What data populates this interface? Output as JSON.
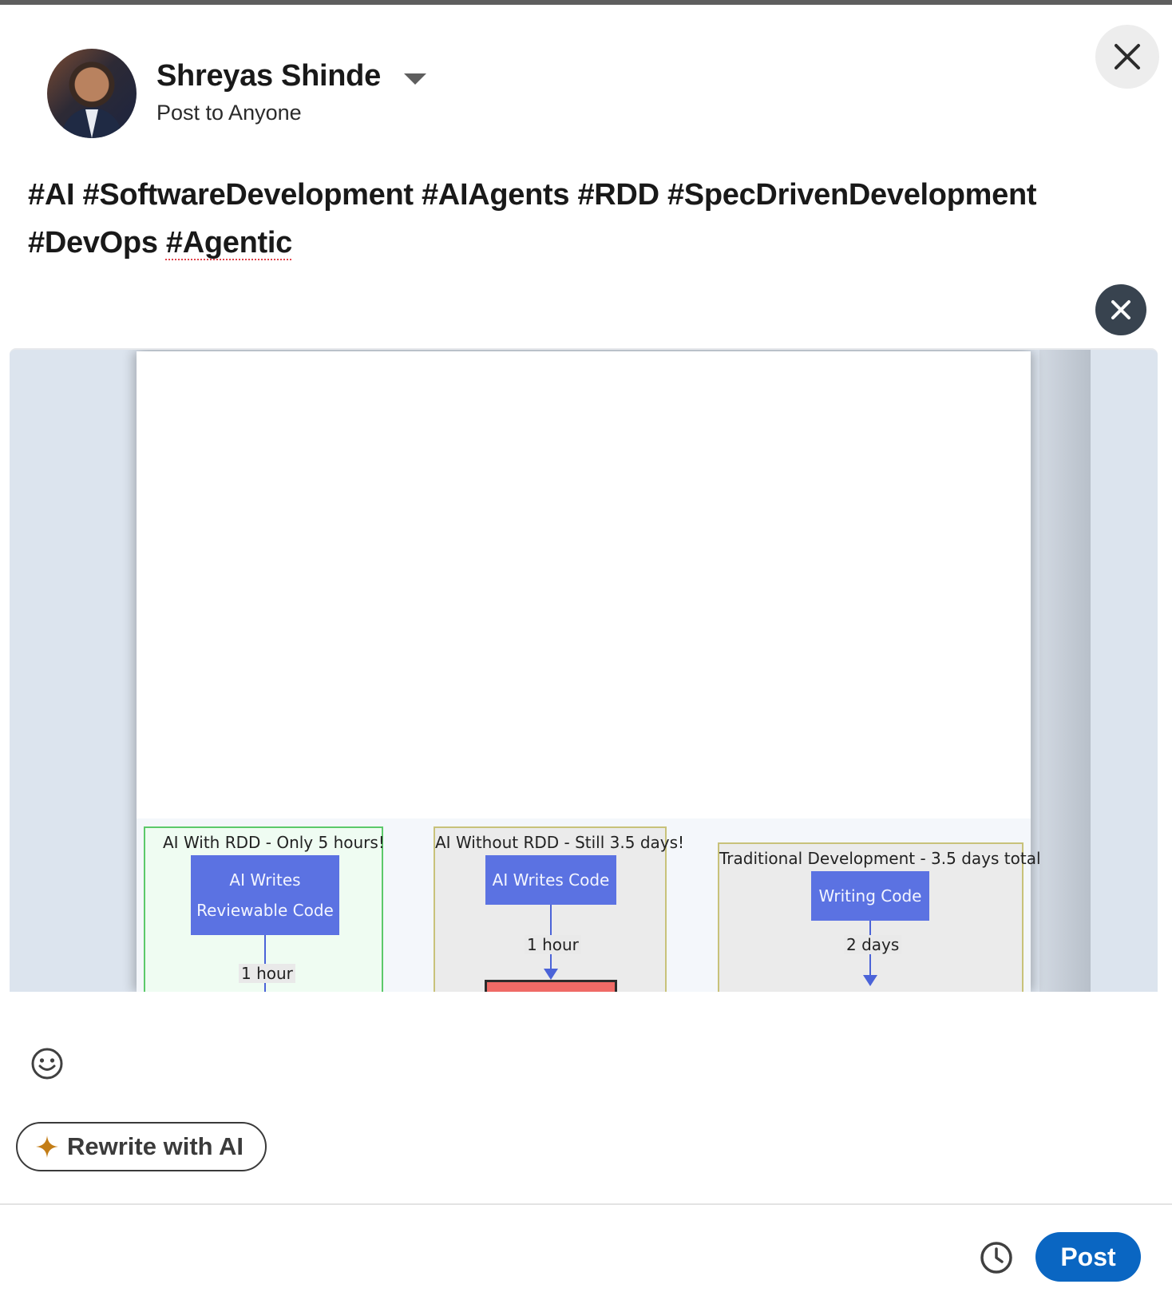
{
  "author": {
    "name": "Shreyas Shinde",
    "audience": "Post to Anyone"
  },
  "post": {
    "line1": "#AI #SoftwareDevelopment #AIAgents #RDD #SpecDrivenDevelopment",
    "line2_a": "#DevOps ",
    "line2_b": "#Agentic"
  },
  "diagram": {
    "clusters": [
      {
        "title": "AI With RDD - Only 5 hours!",
        "node_line1": "AI Writes",
        "node_line2": "Reviewable Code",
        "edge_label": "1 hour"
      },
      {
        "title": "AI Without RDD - Still 3.5 days!",
        "node": "AI Writes Code",
        "edge_label": "1 hour"
      },
      {
        "title": "Traditional Development - 3.5 days total",
        "node": "Writing Code",
        "edge_label": "2 days"
      }
    ]
  },
  "toolbar": {
    "rewrite_label": "Rewrite with AI",
    "post_label": "Post"
  },
  "icons": {
    "close": "close-icon",
    "remove_media": "close-icon",
    "emoji": "smiley-icon",
    "sparkle": "sparkle-icon",
    "schedule": "clock-icon"
  },
  "colors": {
    "primary": "#0a66c2",
    "sparkle": "#c37d16",
    "node_fill": "#5b72e2",
    "cluster_green_border": "#5cc96a",
    "cluster_green_fill": "#effcf2",
    "cluster_yellow_border": "#c8c27a",
    "cluster_grey_fill": "#ebebeb",
    "error_node": "#ef6a66"
  }
}
